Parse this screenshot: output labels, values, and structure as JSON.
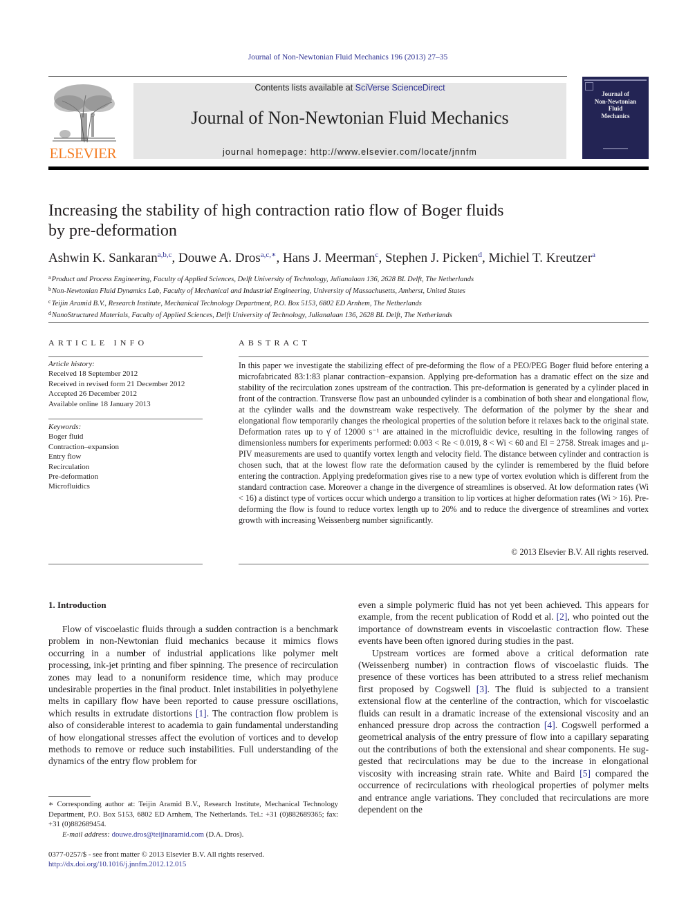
{
  "header": {
    "journal_reference": "Journal of Non-Newtonian Fluid Mechanics 196 (2013) 27–35",
    "contents_prefix": "Contents lists available at ",
    "contents_link": "SciVerse ScienceDirect",
    "journal_title": "Journal of Non-Newtonian Fluid Mechanics",
    "homepage": "journal homepage: http://www.elsevier.com/locate/jnnfm",
    "publisher_logo_text": "ELSEVIER",
    "cover_title_lines": [
      "Journal of",
      "Non-Newtonian",
      "Fluid",
      "Mechanics"
    ],
    "colors": {
      "elsevier_orange": "#f47b20",
      "link_blue": "#2e3192",
      "cover_navy": "#232454",
      "banner_gray": "#e6e6e6"
    }
  },
  "article": {
    "title_line1": "Increasing the stability of high contraction ratio flow of Boger fluids",
    "title_line2": "by pre-deformation",
    "authors": [
      {
        "name": "Ashwin K. Sankaran",
        "sup": "a,b,c",
        "sep": ", "
      },
      {
        "name": "Douwe A. Dros",
        "sup": "a,c,∗",
        "sep": ", "
      },
      {
        "name": "Hans J. Meerman",
        "sup": "c",
        "sep": ", "
      },
      {
        "name": "Stephen J. Picken",
        "sup": "d",
        "sep": ", "
      },
      {
        "name": "Michiel T. Kreutzer",
        "sup": "a",
        "sep": ""
      }
    ],
    "affiliations": [
      {
        "key": "a",
        "text": "Product and Process Engineering, Faculty of Applied Sciences, Delft University of Technology, Julianalaan 136, 2628 BL Delft, The Netherlands"
      },
      {
        "key": "b",
        "text": "Non-Newtonian Fluid Dynamics Lab, Faculty of Mechanical and Industrial Engineering, University of Massachusetts, Amherst, United States"
      },
      {
        "key": "c",
        "text": "Teijin Aramid B.V., Research Institute, Mechanical Technology Department, P.O. Box 5153, 6802 ED Arnhem, The Netherlands"
      },
      {
        "key": "d",
        "text": "NanoStructured Materials, Faculty of Applied Sciences, Delft University of Technology, Julianalaan 136, 2628 BL Delft, The Netherlands"
      }
    ]
  },
  "article_info": {
    "heading": "ARTICLE INFO",
    "history_label": "Article history:",
    "history": [
      "Received 18 September 2012",
      "Received in revised form 21 December 2012",
      "Accepted 26 December 2012",
      "Available online 18 January 2013"
    ],
    "keywords_label": "Keywords:",
    "keywords": [
      "Boger fluid",
      "Contraction–expansion",
      "Entry flow",
      "Recirculation",
      "Pre-deformation",
      "Microfluidics"
    ]
  },
  "abstract": {
    "heading": "ABSTRACT",
    "text": "In this paper we investigate the stabilizing effect of pre-deforming the flow of a PEO/PEG Boger fluid before entering a microfabricated 83:1:83 planar contraction–expansion. Applying pre-deformation has a dramatic effect on the size and stability of the recirculation zones upstream of the contraction. This pre-deformation is generated by a cylinder placed in front of the contraction. Transverse flow past an unbounded cylinder is a combination of both shear and elongational flow, at the cylinder walls and the downstream wake respectively. The deformation of the polymer by the shear and elongational flow temporarily changes the rheological properties of the solution before it relaxes back to the original state. Deformation rates up to γ̇ of 12000 s⁻¹ are attained in the microfluidic device, resulting in the following ranges of dimensionless numbers for experiments performed: 0.003 < Re < 0.019, 8 < Wi < 60 and El = 2758. Streak images and μ-PIV measurements are used to quantify vortex length and velocity field. The distance between cylinder and contraction is chosen such, that at the lowest flow rate the deforma­tion caused by the cylinder is remembered by the fluid before entering the contraction. Applying pre­deformation gives rise to a new type of vortex evolution which is different from the standard contraction case. Moreover a change in the divergence of streamlines is observed. At low deformation rates (Wi < 16) a distinct type of vortices occur which undergo a transition to lip vortices at higher deformation rates (Wi > 16). Pre-deforming the flow is found to reduce vortex length up to 20% and to reduce the divergence of streamlines and vortex growth with increasing Weissenberg number significantly.",
    "copyright": "© 2013 Elsevier B.V. All rights reserved."
  },
  "introduction": {
    "heading": "1. Introduction",
    "left_para1_parts": [
      "Flow of viscoelastic fluids through a sudden contraction is a benchmark problem in non-Newtonian fluid mechanics because it mimics flows occurring in a number of industrial applications like polymer melt processing, ink-jet printing and fiber spinning. The presence of recirculation zones may lead to a nonuniform res­idence time, which may produce undesirable properties in the final product. Inlet instabilities in polyethylene melts in capillary flow have been reported to cause pressure oscillations, which results in extrudate distortions ",
      "[1]",
      ". The contraction flow problem is also of considerable interest to academia to gain fundamental under­standing of how elongational stresses affect the evolution of vorti­ces and to develop methods to remove or reduce such instabilities. Full understanding of the dynamics of the entry flow problem for"
    ],
    "right_para1_parts": [
      "even a simple polymeric fluid has not yet been achieved. This ap­pears for example, from the recent publication of Rodd et al. ",
      "[2]",
      ", who pointed out the importance of downstream events in visco­elastic contraction flow. These events have been often ignored dur­ing studies in the past."
    ],
    "right_para2_parts": [
      "Upstream vortices are formed above a critical deformation rate (Weissenberg number) in contraction flows of viscoelastic fluids. The presence of these vortices has been attributed to a stress relief mechanism first proposed by Cogswell ",
      "[3]",
      ". The fluid is subjected to a transient extensional flow at the centerline of the contraction, which for viscoelastic fluids can result in a dramatic increase of the extensional viscosity and an enhanced pressure drop across the contraction ",
      "[4]",
      ". Cogswell performed a geometrical analysis of the entry pressure of flow into a capillary separating out the con­tributions of both the extensional and shear components. He sug­gested that recirculations may be due to the increase in elongational viscosity with increasing strain rate. White and Baird ",
      "[5]",
      " compared the occurrence of recirculations with rheological properties of polymer melts and entrance angle variations. They concluded that recirculations are more dependent on the"
    ]
  },
  "footnote": {
    "corresponding": "∗ Corresponding author at: Teijin Aramid B.V., Research Institute, Mechanical Technology Department, P.O. Box 5153, 6802 ED Arnhem, The Netherlands. Tel.: +31 (0)882689365; fax: +31 (0)882689454.",
    "email_label": "E-mail address: ",
    "email": "douwe.dros@teijinaramid.com",
    "email_suffix": " (D.A. Dros)."
  },
  "front_matter": {
    "issn_line": "0377-0257/$ - see front matter © 2013 Elsevier B.V. All rights reserved.",
    "doi": "http://dx.doi.org/10.1016/j.jnnfm.2012.12.015"
  }
}
